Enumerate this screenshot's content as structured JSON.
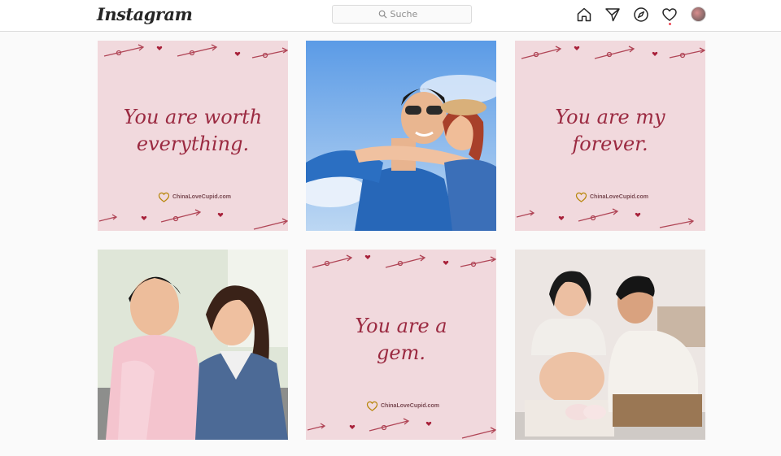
{
  "header": {
    "logo": "Instagram",
    "search_placeholder": "Suche",
    "icons": [
      "home-icon",
      "direct-icon",
      "explore-icon",
      "activity-heart-icon",
      "profile-avatar"
    ]
  },
  "posts": [
    {
      "type": "quote",
      "text_line1": "You are worth",
      "text_line2": "everything.",
      "brand": "ChinaLoveCupid.com"
    },
    {
      "type": "photo",
      "subject": "couple-piggyback-photo"
    },
    {
      "type": "quote",
      "text_line1": "You are my",
      "text_line2": "forever.",
      "brand": "ChinaLoveCupid.com"
    },
    {
      "type": "photo",
      "subject": "couple-on-couch-photo"
    },
    {
      "type": "quote",
      "text_line1": "You are a",
      "text_line2": "gem.",
      "brand": "ChinaLoveCupid.com"
    },
    {
      "type": "photo",
      "subject": "pregnant-couple-photo"
    }
  ],
  "colors": {
    "quote_bg": "#f1d9dd",
    "quote_text": "#9b2a41",
    "notification": "#ed4956"
  }
}
